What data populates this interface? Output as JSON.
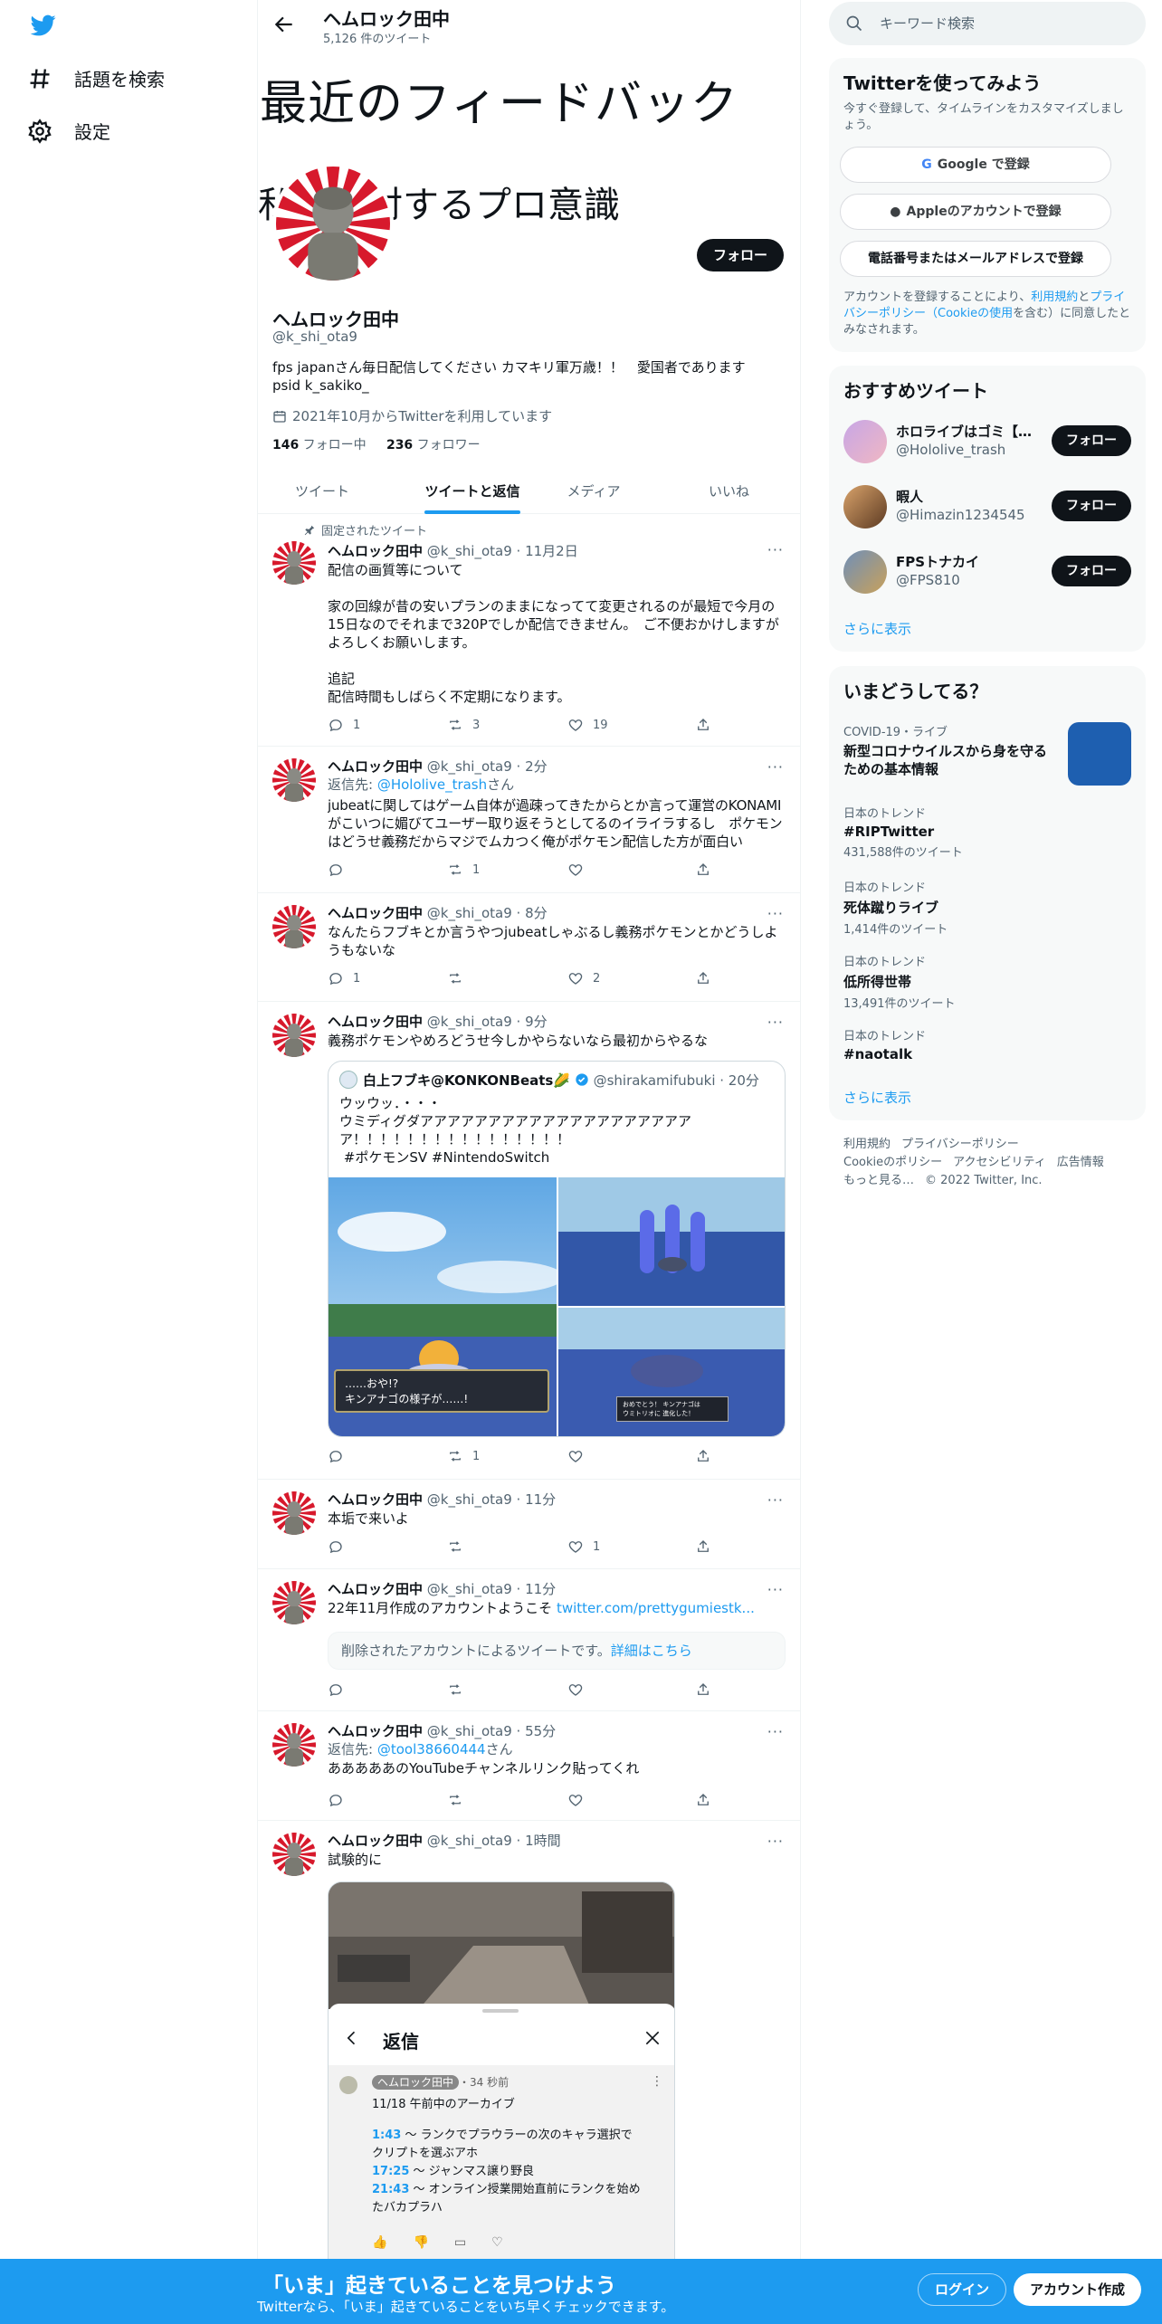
{
  "nav": {
    "explore": "話題を検索",
    "settings": "設定"
  },
  "header": {
    "name": "ヘムロック田中",
    "tweet_count": "5,126 件のツイート"
  },
  "banner": {
    "line1": "最近のフィードバック",
    "line2": "私　に対するプロ意識"
  },
  "profile": {
    "follow": "フォロー",
    "name": "ヘムロック田中",
    "handle": "@k_shi_ota9",
    "bio": "fps japanさん毎日配信してください カマキリ軍万歳！！　愛国者であります\npsid k_sakiko_",
    "joined": "2021年10月からTwitterを利用しています",
    "following_count": "146",
    "following_label": " フォロー中",
    "followers_count": "236",
    "followers_label": " フォロワー"
  },
  "tabs": [
    "ツイート",
    "ツイートと返信",
    "メディア",
    "いいね"
  ],
  "tweets": [
    {
      "pinned": "固定されたツイート",
      "name": "ヘムロック田中",
      "meta": "@k_shi_ota9 · 11月2日",
      "text": "配信の画質等について\n\n家の回線が昔の安いプランのままになってて変更されるのが最短で今月の15日なのでそれまで320Pでしか配信できません。　ご不便おかけしますがよろしくお願いします。\n\n追記\n配信時間もしばらく不定期になります。",
      "reply": "1",
      "rt": "3",
      "like": "19"
    },
    {
      "name": "ヘムロック田中",
      "meta": "@k_shi_ota9 · 2分",
      "reply_prefix": "返信先: ",
      "reply_to": "@Hololive_trash",
      "reply_suffix": "さん",
      "text": "jubeatに関してはゲーム自体が過疎ってきたからとか言って運営のKONAMIがこいつに媚びてユーザー取り返そうとしてるのイライラするし　ポケモンはどうせ義務だからマジでムカつく俺がポケモン配信した方が面白い",
      "reply": "",
      "rt": "1",
      "like": ""
    },
    {
      "name": "ヘムロック田中",
      "meta": "@k_shi_ota9 · 8分",
      "text": "なんたらフブキとか言うやつjubeatしゃぶるし義務ポケモンとかどうしようもないな",
      "reply": "1",
      "rt": "",
      "like": "2"
    },
    {
      "name": "ヘムロック田中",
      "meta": "@k_shi_ota9 · 9分",
      "text": "義務ポケモンやめろどうせ今しかやらないなら最初からやるな",
      "reply": "",
      "rt": "1",
      "like": "",
      "quote": {
        "name": "白上フブキ@KONKONBeats🌽",
        "handle": "@shirakamifubuki · 20分",
        "text": "ウッウッ．・・・\nウミディグダアアアアアアアアアアアアアアアアアアアアア！！！！！！！！！！！！！！！！\n #ポケモンSV #NintendoSwitch",
        "caption1": "……おや!?",
        "caption2": "キンアナゴの様子が……!",
        "caption3": "おめでとう！ キンアナゴは\nウミトリオに 進化した！"
      }
    },
    {
      "name": "ヘムロック田中",
      "meta": "@k_shi_ota9 · 11分",
      "text": "本垢で来いよ",
      "reply": "",
      "rt": "",
      "like": "1"
    },
    {
      "name": "ヘムロック田中",
      "meta": "@k_shi_ota9 · 11分",
      "text": "22年11月作成のアカウントようこそ ",
      "link": "twitter.com/prettygumiestk...",
      "deleted": "削除されたアカウントによるツイートです。",
      "deleted_link": "詳細はこちら",
      "reply": "",
      "rt": "",
      "like": ""
    },
    {
      "name": "ヘムロック田中",
      "meta": "@k_shi_ota9 · 55分",
      "reply_prefix": "返信先: ",
      "reply_to": "@tool38660444",
      "reply_suffix": "さん",
      "text": "あああああのYouTubeチャンネルリンク貼ってくれ",
      "reply": "",
      "rt": "",
      "like": ""
    },
    {
      "name": "ヘムロック田中",
      "meta": "@k_shi_ota9 · 1時間",
      "text": "試験的に",
      "shot": {
        "title": "返信",
        "comment_user": "ヘムロック田中",
        "comment_time": "・34 秒前",
        "comment_head": "11/18 午前中のアーカイブ",
        "t1": "1:43",
        "l1": " 〜 ランクでプラウラーの次のキャラ選択でクリプトを選ぶアホ",
        "t2": "17:25",
        "l2": " 〜 ジャンマス譲り野良",
        "t3": "21:43",
        "l3": " 〜 オンライン授業開始直前にランクを始めたバカプラハ"
      }
    }
  ],
  "right": {
    "search_placeholder": "キーワード検索",
    "signup": {
      "title": "Twitterを使ってみよう",
      "desc": "今すぐ登録して、タイムラインをカスタマイズしましょう。",
      "google": "Google で登録",
      "apple": "Appleのアカウントで登録",
      "phone": "電話番号またはメールアドレスで登録",
      "terms_pre": "アカウントを登録することにより、",
      "terms_link1": "利用規約",
      "terms_mid": "と",
      "terms_link2": "プライバシーポリシー（Cookieの使用",
      "terms_post": "を含む）に同意したとみなされます。"
    },
    "recs": {
      "title": "おすすめツイート",
      "items": [
        {
          "name": "ホロライブはゴミ【…",
          "handle": "@Hololive_trash"
        },
        {
          "name": "暇人",
          "handle": "@Himazin1234545"
        },
        {
          "name": "FPSトナカイ",
          "handle": "@FPS810"
        }
      ],
      "follow": "フォロー",
      "more": "さらに表示"
    },
    "trends": {
      "title": "いまどうしてる？",
      "items": [
        {
          "cat": "COVID-19・ライブ",
          "title": "新型コロナウイルスから身を守るための基本情報",
          "count": ""
        },
        {
          "cat": "日本のトレンド",
          "title": "#RIPTwitter",
          "count": "431,588件のツイート"
        },
        {
          "cat": "日本のトレンド",
          "title": "死体蹴りライブ",
          "count": "1,414件のツイート"
        },
        {
          "cat": "日本のトレンド",
          "title": "低所得世帯",
          "count": "13,491件のツイート"
        },
        {
          "cat": "日本のトレンド",
          "title": "#naotalk",
          "count": ""
        }
      ],
      "more": "さらに表示"
    },
    "footer": {
      "terms": "利用規約",
      "privacy": "プライバシーポリシー",
      "cookie": "Cookieのポリシー",
      "a11y": "アクセシビリティ",
      "ads": "広告情報",
      "more": "もっと見る…",
      "copy": "© 2022 Twitter, Inc."
    }
  },
  "bottom": {
    "title": "「いま」起きていることを見つけよう",
    "sub": "Twitterなら、「いま」起きていることをいち早くチェックできます。",
    "login": "ログイン",
    "signup": "アカウント作成"
  },
  "colors": {
    "accent": "#1d9bf0",
    "dark": "#0f1419",
    "muted": "#536471"
  }
}
